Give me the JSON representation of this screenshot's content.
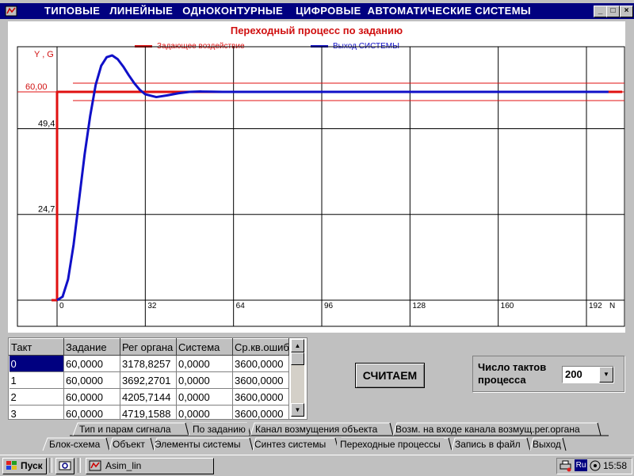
{
  "window": {
    "menu_title": "ТИПОВЫЕ   ЛИНЕЙНЫЕ   ОДНОКОНТУРНЫЕ    ЦИФРОВЫЕ  АВТОМАТИЧЕСКИЕ СИСТЕМЫ",
    "minimize_glyph": "_",
    "maximize_glyph": "□",
    "close_glyph": "×"
  },
  "chart_data": {
    "type": "line",
    "title": "Переходный процесс по заданию",
    "ylabel": "Y , G",
    "xlabel": "N",
    "xlim": [
      0,
      205
    ],
    "ylim": [
      0,
      73
    ],
    "x_ticks": [
      "0",
      "32",
      "64",
      "96",
      "128",
      "160",
      "192"
    ],
    "y_ticks": [
      "24,7",
      "49,4",
      "60,00"
    ],
    "tolerance_band": [
      57.5,
      62.5
    ],
    "series": [
      {
        "name": "Задающее воздействие",
        "color": "#e01010",
        "x": [
          -2,
          0,
          0,
          205
        ],
        "y": [
          0,
          0,
          60,
          60
        ]
      },
      {
        "name": "Выход СИСТЕМЫ",
        "color": "#1010c8",
        "x": [
          0,
          2,
          4,
          6,
          8,
          10,
          12,
          14,
          16,
          18,
          20,
          22,
          24,
          26,
          28,
          30,
          32,
          36,
          40,
          44,
          48,
          52,
          56,
          60,
          64,
          70,
          80,
          96,
          128,
          160,
          192,
          200
        ],
        "y": [
          0,
          1,
          6,
          16,
          29,
          42,
          53,
          62,
          67.5,
          70,
          70.5,
          69.4,
          67.3,
          64.8,
          62.5,
          60.6,
          59.3,
          58.5,
          59.0,
          59.6,
          60.0,
          60.1,
          60.05,
          60,
          60,
          60,
          60,
          60,
          60,
          60,
          60,
          60
        ]
      }
    ]
  },
  "table": {
    "columns": [
      "Такт",
      "Задание",
      "Рег органа",
      "Система",
      "Ср.кв.ошибка"
    ],
    "rows": [
      [
        "0",
        "60,0000",
        "3178,8257",
        "0,0000",
        "3600,0000"
      ],
      [
        "1",
        "60,0000",
        "3692,2701",
        "0,0000",
        "3600,0000"
      ],
      [
        "2",
        "60,0000",
        "4205,7144",
        "0,0000",
        "3600,0000"
      ],
      [
        "3",
        "60,0000",
        "4719,1588",
        "0,0000",
        "3600,0000"
      ]
    ]
  },
  "calculate_button": "СЧИТАЕМ",
  "steps_group": {
    "label": "Число тактов процесса",
    "value": "200"
  },
  "tabs_upper": [
    "Тип  и парам сигнала",
    "По заданию",
    "Канал возмущения объекта",
    "Возм. на входе канала возмущ.рег.органа"
  ],
  "tabs_lower": [
    "Блок-схема",
    "Объект",
    "Элементы системы",
    "Синтез системы",
    "Переходные процессы",
    "Запись в файл",
    "Выход"
  ],
  "taskbar": {
    "start_label": "Пуск",
    "task_label": "Asim_lin",
    "lang": "Ru",
    "clock": "15:58"
  },
  "colors": {
    "titlebar": "#000080",
    "reference": "#e01010",
    "output": "#1010c8",
    "title_text": "#d01010"
  }
}
